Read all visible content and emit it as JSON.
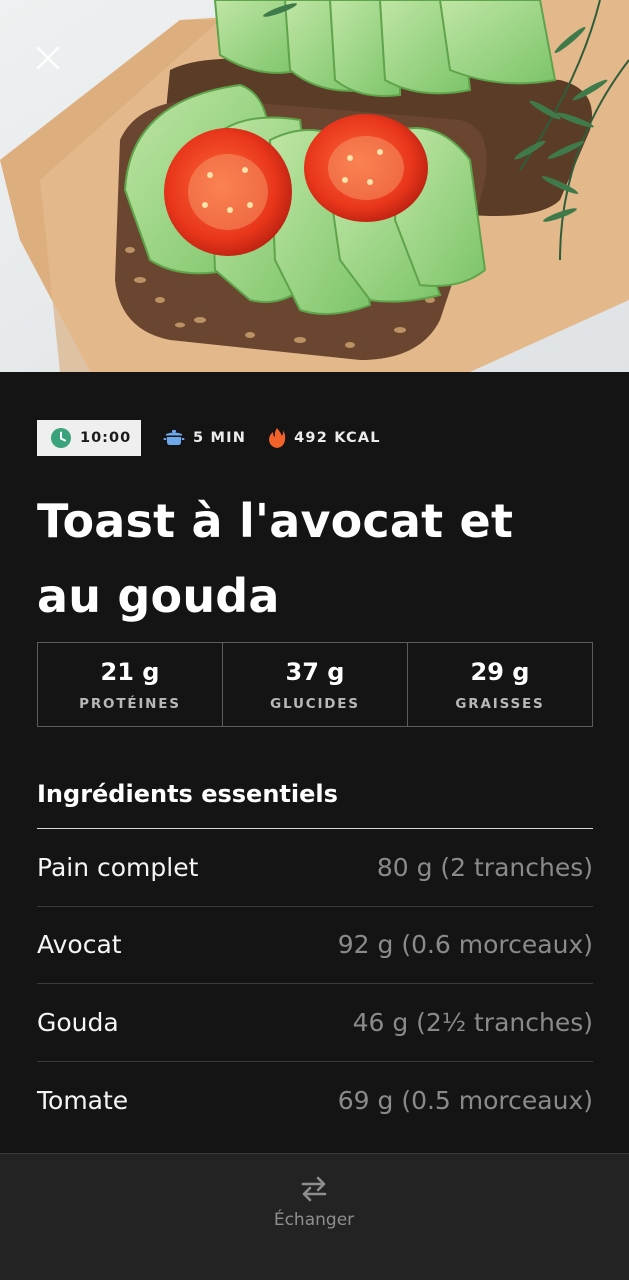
{
  "hero": {
    "image_alt": "Toast à l'avocat et au gouda"
  },
  "meta": {
    "time": "10:00",
    "duration": "5 MIN",
    "calories": "492 KCAL"
  },
  "recipe": {
    "title": "Toast à l'avocat et au gouda"
  },
  "macros": [
    {
      "value": "21 g",
      "label": "PROTÉINES"
    },
    {
      "value": "37 g",
      "label": "GLUCIDES"
    },
    {
      "value": "29 g",
      "label": "GRAISSES"
    }
  ],
  "ingredients": {
    "heading": "Ingrédients essentiels",
    "items": [
      {
        "name": "Pain complet",
        "qty": "80 g (2 tranches)"
      },
      {
        "name": "Avocat",
        "qty": "92 g (0.6 morceaux)"
      },
      {
        "name": "Gouda",
        "qty": "46 g (2½ tranches)"
      },
      {
        "name": "Tomate",
        "qty": "69 g (0.5 morceaux)"
      }
    ]
  },
  "bottom_bar": {
    "swap_label": "Échanger"
  },
  "colors": {
    "background": "#141414",
    "clock_green": "#3aa37b",
    "pot_blue": "#6fa8ea",
    "flame_orange": "#f2622a"
  },
  "icons": {
    "close": "close-icon",
    "clock": "clock-icon",
    "pot": "pot-icon",
    "flame": "flame-icon",
    "swap": "swap-arrows-icon"
  }
}
